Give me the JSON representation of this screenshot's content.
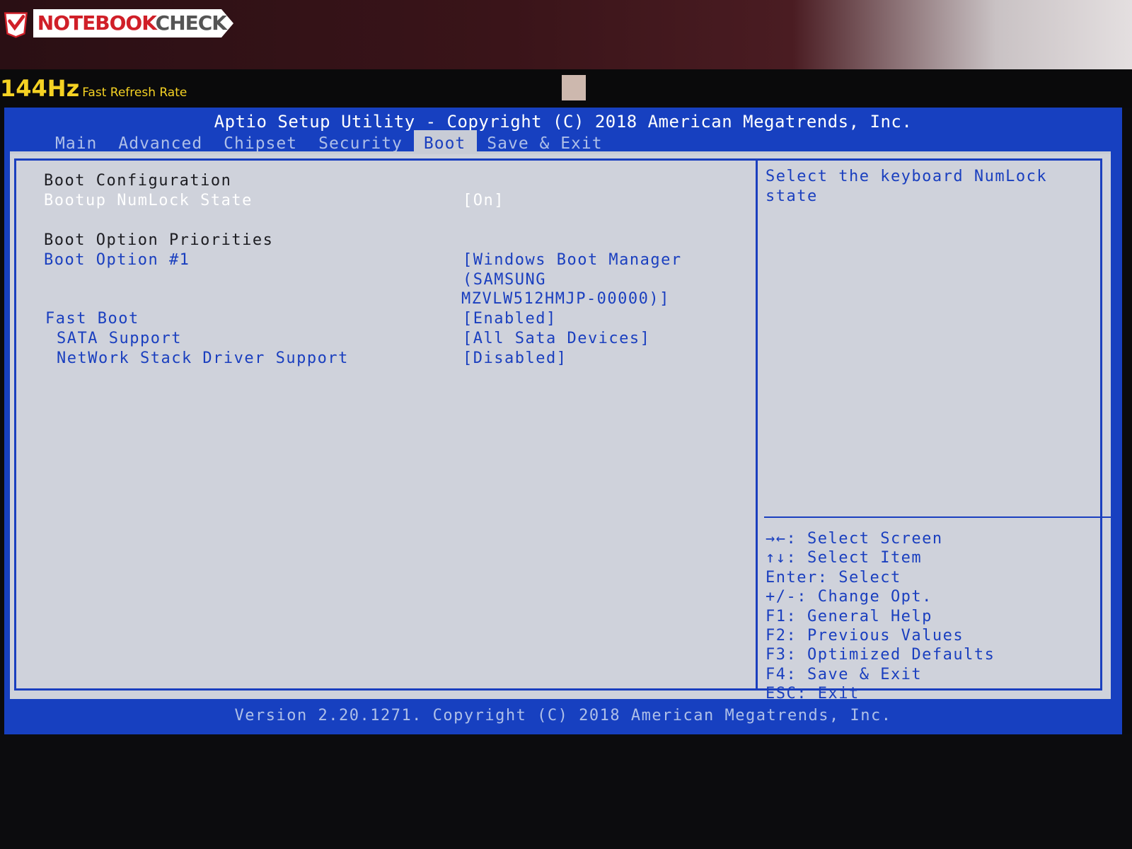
{
  "watermark": {
    "brand_main": "NOTEBOOK",
    "brand_accent": "CHECK",
    "accent_color": "#d01f28"
  },
  "sticker": {
    "refresh": "144Hz",
    "label": "Fast Refresh Rate"
  },
  "bios": {
    "title": "Aptio Setup Utility - Copyright (C) 2018 American Megatrends, Inc.",
    "tabs": [
      {
        "label": "Main",
        "active": false
      },
      {
        "label": "Advanced",
        "active": false
      },
      {
        "label": "Chipset",
        "active": false
      },
      {
        "label": "Security",
        "active": false
      },
      {
        "label": "Boot",
        "active": true
      },
      {
        "label": "Save & Exit",
        "active": false
      }
    ],
    "sections": {
      "boot_config": "Boot Configuration",
      "boot_priorities": "Boot Option Priorities"
    },
    "items": {
      "numlock_label": "Bootup NumLock State",
      "numlock_value": "[On]",
      "boot_option1_label": "Boot Option #1",
      "boot_option1_value_line1": "[Windows Boot Manager",
      "boot_option1_value_line2": "(SAMSUNG",
      "boot_option1_value_line3": "MZVLW512HMJP-00000)]",
      "fast_boot_label": "Fast Boot",
      "fast_boot_value": "[Enabled]",
      "sata_label": "SATA Support",
      "sata_value": "[All Sata Devices]",
      "network_label": "NetWork Stack Driver Support",
      "network_value": "[Disabled]"
    },
    "help_text": "Select the keyboard NumLock state",
    "key_help": [
      "→←: Select Screen",
      "↑↓: Select Item",
      "Enter: Select",
      "+/-: Change Opt.",
      "F1: General Help",
      "F2: Previous Values",
      "F3: Optimized Defaults",
      "F4: Save & Exit",
      "ESC: Exit"
    ],
    "footer": "Version 2.20.1271. Copyright (C) 2018 American Megatrends, Inc.",
    "colors": {
      "blue": "#1740c0",
      "panel": "#cfd2db",
      "text_blue": "#1a3fbf"
    }
  }
}
